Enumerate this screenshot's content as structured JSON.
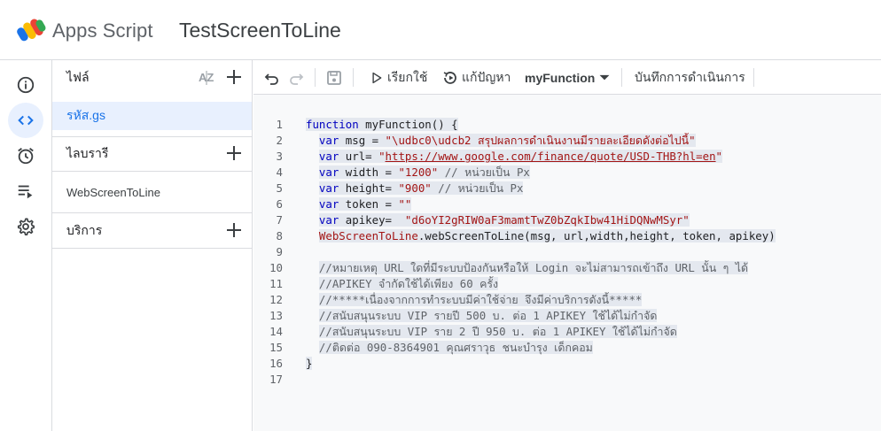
{
  "header": {
    "app_name": "Apps Script",
    "project_name": "TestScreenToLine"
  },
  "rail": [
    {
      "name": "overview",
      "icon": "info-icon"
    },
    {
      "name": "editor",
      "icon": "code-icon",
      "active": true
    },
    {
      "name": "triggers",
      "icon": "alarm-icon"
    },
    {
      "name": "executions",
      "icon": "executions-icon"
    },
    {
      "name": "settings",
      "icon": "gear-icon"
    }
  ],
  "files_panel": {
    "files_label": "ไฟล์",
    "active_file": "รหัส.gs",
    "libraries_label": "ไลบรารี",
    "library_item": "WebScreenToLine",
    "services_label": "บริการ"
  },
  "toolbar": {
    "run_label": "เรียกใช้",
    "debug_label": "แก้ปัญหา",
    "function_name": "myFunction",
    "execution_log_label": "บันทึกการดำเนินการ"
  },
  "code_lines": [
    "function myFunction() {",
    "  var msg = \"\\udbc0\\udcb2 สรุปผลการดำเนินงานมีรายละเอียดดังต่อไปนี้\"",
    "  var url= \"https://www.google.com/finance/quote/USD-THB?hl=en\"",
    "  var width = \"1200\" // หน่วยเป็น Px",
    "  var height= \"900\" // หน่วยเป็น Px",
    "  var token = \"\"",
    "  var apikey=  \"d6oYI2gRIW0aF3mamtTwZ0bZqkIbw41HiDQNwMSyr\"",
    "  WebScreenToLine.webScreenToLine(msg, url,width,height, token, apikey)",
    "",
    "  //หมายเหตุ URL ใดที่มีระบบป้องกันหรือให้ Login จะไม่สามารถเข้าถึง URL นั้น ๆ ได้",
    "  //APIKEY จำกัดใช้ได้เพียง 60 ครั้ง",
    "  //*****เนื่องจากการทำระบบมีค่าใช้จ่าย จึงมีค่าบริการดังนี้*****",
    "  //สนับสนุนระบบ VIP รายปี 500 บ. ต่อ 1 APIKEY ใช้ได้ไม่กำจัด",
    "  //สนับสนุนระบบ VIP ราย 2 ปี 950 บ. ต่อ 1 APIKEY ใช้ได้ไม่กำจัด",
    "  //ติดต่อ 090-8364901 คุณศราวุธ ชนะบำรุง เด็กคอม",
    "}",
    ""
  ],
  "colors": {
    "accent": "#1a73e8",
    "active_bg": "#e8f0fe",
    "border": "#dadce0"
  }
}
